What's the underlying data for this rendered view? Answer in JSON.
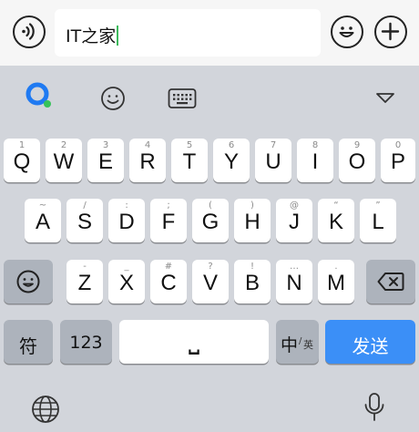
{
  "input": {
    "text": "IT之家"
  },
  "rows": [
    [
      {
        "l": "Q",
        "h": "1"
      },
      {
        "l": "W",
        "h": "2"
      },
      {
        "l": "E",
        "h": "3"
      },
      {
        "l": "R",
        "h": "4"
      },
      {
        "l": "T",
        "h": "5"
      },
      {
        "l": "Y",
        "h": "6"
      },
      {
        "l": "U",
        "h": "7"
      },
      {
        "l": "I",
        "h": "8"
      },
      {
        "l": "O",
        "h": "9"
      },
      {
        "l": "P",
        "h": "0"
      }
    ],
    [
      {
        "l": "A",
        "h": "~"
      },
      {
        "l": "S",
        "h": "/"
      },
      {
        "l": "D",
        "h": ":"
      },
      {
        "l": "F",
        "h": ";"
      },
      {
        "l": "G",
        "h": "("
      },
      {
        "l": "H",
        "h": ")"
      },
      {
        "l": "J",
        "h": "@"
      },
      {
        "l": "K",
        "h": "“"
      },
      {
        "l": "L",
        "h": "”"
      }
    ],
    [
      {
        "l": "Z",
        "h": "-"
      },
      {
        "l": "X",
        "h": "_"
      },
      {
        "l": "C",
        "h": "#"
      },
      {
        "l": "V",
        "h": "?"
      },
      {
        "l": "B",
        "h": "!"
      },
      {
        "l": "N",
        "h": "…"
      },
      {
        "l": "M",
        "h": "."
      }
    ]
  ],
  "keys": {
    "symbol": "符",
    "numeric": "123",
    "space": "⎵",
    "lang_main": "中",
    "lang_sep": "/",
    "lang_sub": "英",
    "send": "发送"
  }
}
